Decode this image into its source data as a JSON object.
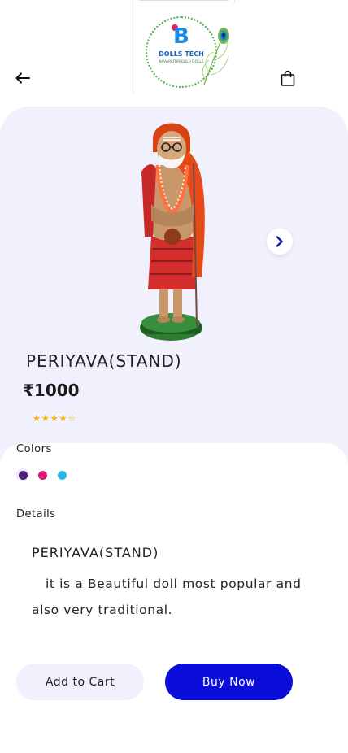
{
  "header": {
    "logo_letter": "B",
    "logo_brand": "DOLLS TECH",
    "logo_tagline": "NAVARATHRIGOLU DOLLS",
    "back_icon": "arrow-left-icon",
    "cart_icon": "shopping-bag-icon"
  },
  "product": {
    "name": "PERIYAVA(STAND)",
    "price": "₹1000",
    "rating_stars": 4,
    "rating_max": 5,
    "image_icon": "product-doll-image",
    "next_icon": "chevron-right-icon"
  },
  "colors": {
    "label": "Colors",
    "options": [
      {
        "name": "purple",
        "hex": "#4a1f7a",
        "selected": true
      },
      {
        "name": "pink",
        "hex": "#d81b74",
        "selected": false
      },
      {
        "name": "cyan",
        "hex": "#29b6e8",
        "selected": false
      }
    ]
  },
  "details": {
    "label": "Details",
    "title": "PERIYAVA(STAND)",
    "body": "it is a Beautiful doll most popular and also very traditional."
  },
  "actions": {
    "add_to_cart": "Add to Cart",
    "buy_now": "Buy Now"
  },
  "theme": {
    "accent": "#0a0ed8",
    "panel_bg": "#f1f0fd",
    "star": "#f4b400"
  }
}
